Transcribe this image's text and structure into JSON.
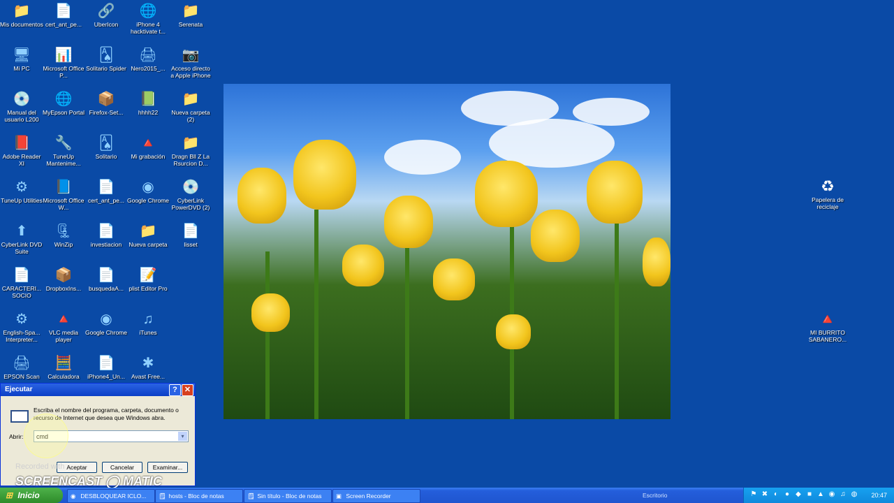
{
  "desktop": {
    "icons": [
      {
        "label": "Mis documentos",
        "glyph": "📁"
      },
      {
        "label": "cert_ant_pe...",
        "glyph": "📄"
      },
      {
        "label": "UberIcon",
        "glyph": "🔗"
      },
      {
        "label": "iPhone 4 hacktivate t...",
        "glyph": "🌐"
      },
      {
        "label": "Serenata",
        "glyph": "📁"
      },
      {
        "label": "Mi PC",
        "glyph": "🖥"
      },
      {
        "label": "Microsoft Office P...",
        "glyph": "📊"
      },
      {
        "label": "Solitario Spider",
        "glyph": "🂡"
      },
      {
        "label": "Nero2015_...",
        "glyph": "🖨"
      },
      {
        "label": "Acceso directo a Apple iPhone",
        "glyph": "📷"
      },
      {
        "label": "Manual del usuario L200",
        "glyph": "💿"
      },
      {
        "label": "MyEpson Portal",
        "glyph": "🌐"
      },
      {
        "label": "Firefox-Set...",
        "glyph": "📦"
      },
      {
        "label": "hhhh22",
        "glyph": "📗"
      },
      {
        "label": "Nueva carpeta (2)",
        "glyph": "📁"
      },
      {
        "label": "Adobe Reader XI",
        "glyph": "📕"
      },
      {
        "label": "TuneUp Mantenime...",
        "glyph": "🔧"
      },
      {
        "label": "Solitario",
        "glyph": "🂡"
      },
      {
        "label": "Mi grabación",
        "glyph": "🔺"
      },
      {
        "label": "Dragn Bll Z La Rsurcion D...",
        "glyph": "📁"
      },
      {
        "label": "TuneUp Utilities",
        "glyph": "⚙"
      },
      {
        "label": "Microsoft Office W...",
        "glyph": "📘"
      },
      {
        "label": "cert_ant_pe...",
        "glyph": "📄"
      },
      {
        "label": "Google Chrome",
        "glyph": "◉"
      },
      {
        "label": "CyberLink PowerDVD (2)",
        "glyph": "💿"
      },
      {
        "label": "CyberLink DVD Suite",
        "glyph": "⬆"
      },
      {
        "label": "WinZip",
        "glyph": "🗜"
      },
      {
        "label": "investiacion",
        "glyph": "📄"
      },
      {
        "label": "Nueva carpeta",
        "glyph": "📁"
      },
      {
        "label": "lisset",
        "glyph": "📄"
      },
      {
        "label": "CARACTERI... SOCIO",
        "glyph": "📄"
      },
      {
        "label": "DropboxIns...",
        "glyph": "📦"
      },
      {
        "label": "busquedaA...",
        "glyph": "📄"
      },
      {
        "label": "plist Editor Pro",
        "glyph": "📝"
      },
      {
        "label": "",
        "glyph": ""
      },
      {
        "label": "English-Spa... Interpreter...",
        "glyph": "⚙"
      },
      {
        "label": "VLC media player",
        "glyph": "🔺"
      },
      {
        "label": "Google Chrome",
        "glyph": "◉"
      },
      {
        "label": "iTunes",
        "glyph": "♫"
      },
      {
        "label": "",
        "glyph": ""
      },
      {
        "label": "EPSON Scan",
        "glyph": "🖨"
      },
      {
        "label": "Calculadora",
        "glyph": "🧮"
      },
      {
        "label": "iPhone4_Un...",
        "glyph": "📄"
      },
      {
        "label": "Avast Free...",
        "glyph": "✱"
      },
      {
        "label": "",
        "glyph": ""
      }
    ],
    "right_icons": [
      {
        "label": "Papelera de reciclaje",
        "glyph": "♻"
      },
      {
        "label": "MI BURRITO SABANERO...",
        "glyph": "🔺"
      }
    ]
  },
  "run_dialog": {
    "title": "Ejecutar",
    "help_label": "?",
    "close_label": "✕",
    "description": "Escriba el nombre del programa, carpeta, documento o recurso de Internet que desea que Windows abra.",
    "open_label": "Abrir:",
    "open_value": "cmd",
    "dropdown_arrow": "▾",
    "ok_label": "Aceptar",
    "cancel_label": "Cancelar",
    "browse_label": "Examinar..."
  },
  "overlay": {
    "recorded_text": "Recorded with",
    "watermark": "SCREENCAST ◯ MATIC"
  },
  "taskbar": {
    "start_label": "Inicio",
    "tasks": [
      {
        "label": "DESBLOQUEAR ICLO...",
        "icon": "◉"
      },
      {
        "label": "hosts - Bloc de notas",
        "icon": "🗒"
      },
      {
        "label": "Sin título - Bloc de notas",
        "icon": "🗒"
      },
      {
        "label": "Screen Recorder",
        "icon": "▣"
      }
    ],
    "desktop_label": "Escritorio",
    "clock": "20:47"
  }
}
